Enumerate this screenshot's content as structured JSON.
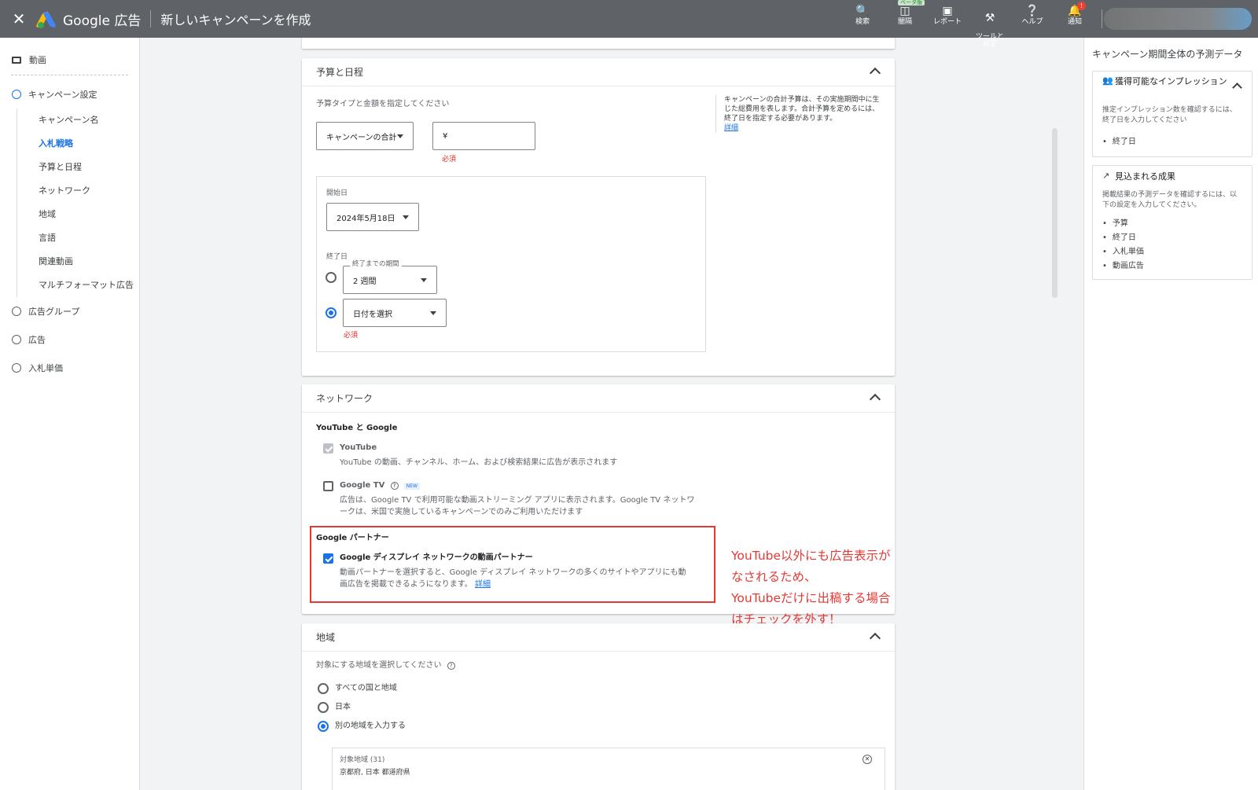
{
  "header": {
    "brand": "Google 広告",
    "title": "新しいキャンペーンを作成",
    "tools": [
      {
        "label": "検索",
        "icon": "search-icon"
      },
      {
        "label": "闇隔",
        "icon": "appearance-icon",
        "badge": "ベータ版"
      },
      {
        "label": "レポート",
        "icon": "report-icon"
      },
      {
        "label": "ツールと\n設定",
        "icon": "wrench-icon"
      },
      {
        "label": "ヘルプ",
        "icon": "help-icon"
      },
      {
        "label": "通知",
        "icon": "bell-icon",
        "alert": "!"
      }
    ]
  },
  "leftnav": {
    "top_item": "動画",
    "steps": [
      {
        "label": "キャンペーン設定",
        "active": true
      },
      {
        "label": "広告グループ"
      },
      {
        "label": "広告"
      },
      {
        "label": "入札単価"
      }
    ],
    "sub_items": [
      "キャンペーン名",
      "入札戦略",
      "予算と日程",
      "ネットワーク",
      "地域",
      "言語",
      "関連動画",
      "マルチフォーマット広告"
    ],
    "active_sub": "入札戦略"
  },
  "budget": {
    "title": "予算と日程",
    "prompt": "予算タイプと金額を指定してください",
    "type_value": "キャンペーンの合計",
    "amount_value": "¥",
    "required": "必須",
    "help_text": "キャンペーンの合計予算は、その実施期間中に生じた総費用を表します。合計予算を定めるには、終了日を指定する必要があります。",
    "help_link": "詳細",
    "start_label": "開始日",
    "start_value": "2024年5月18日",
    "end_label": "終了日",
    "duration_label": "終了までの期間",
    "duration_value": "2 週間",
    "date_value": "日付を選択"
  },
  "network": {
    "title": "ネットワーク",
    "yt_google_heading": "YouTube と Google",
    "youtube_label": "YouTube",
    "youtube_desc": "YouTube の動画、チャンネル、ホーム、および検索結果に広告が表示されます",
    "tv_label": "Google TV",
    "tv_new": "NEW",
    "tv_desc_1": "広告は、Google TV で利用可能な動画ストリーミング アプリに表示されます。Google TV ネットワ",
    "tv_desc_2": "ークは、米国で実施しているキャンペーンでのみご利用いただけます",
    "partner_heading": "Google パートナー",
    "partner_label": "Google ディスプレイ ネットワークの動画パートナー",
    "partner_desc_1": "動画パートナーを選択すると、Google ディスプレイ ネットワークの多くのサイトやアプリにも動",
    "partner_desc_2": "画広告を掲載できるようになります。",
    "partner_link": "詳細",
    "annotation_1": "YouTube以外にも広告表示がなされるため、",
    "annotation_2": "YouTubeだけに出稿する場合はチェックを外す！"
  },
  "location": {
    "title": "地域",
    "prompt": "対象にする地域を選択してください",
    "options": [
      "すべての国と地域",
      "日本",
      "別の地域を入力する"
    ],
    "selected": 2,
    "targets_label": "対象地域 (31)",
    "targets_first": "京都府, 日本 都道府県"
  },
  "rightpanel": {
    "title": "キャンペーン期間全体の予測データ",
    "impressions": {
      "heading": "獲得可能なインプレッション",
      "desc": "推定インプレッション数を確認するには、終了日を入力してください",
      "items": [
        "終了日"
      ]
    },
    "results": {
      "heading": "見込まれる成果",
      "desc": "掲載結果の予測データを確認するには、以下の設定を入力してください。",
      "items": [
        "予算",
        "終了日",
        "入札単価",
        "動画広告"
      ]
    }
  }
}
